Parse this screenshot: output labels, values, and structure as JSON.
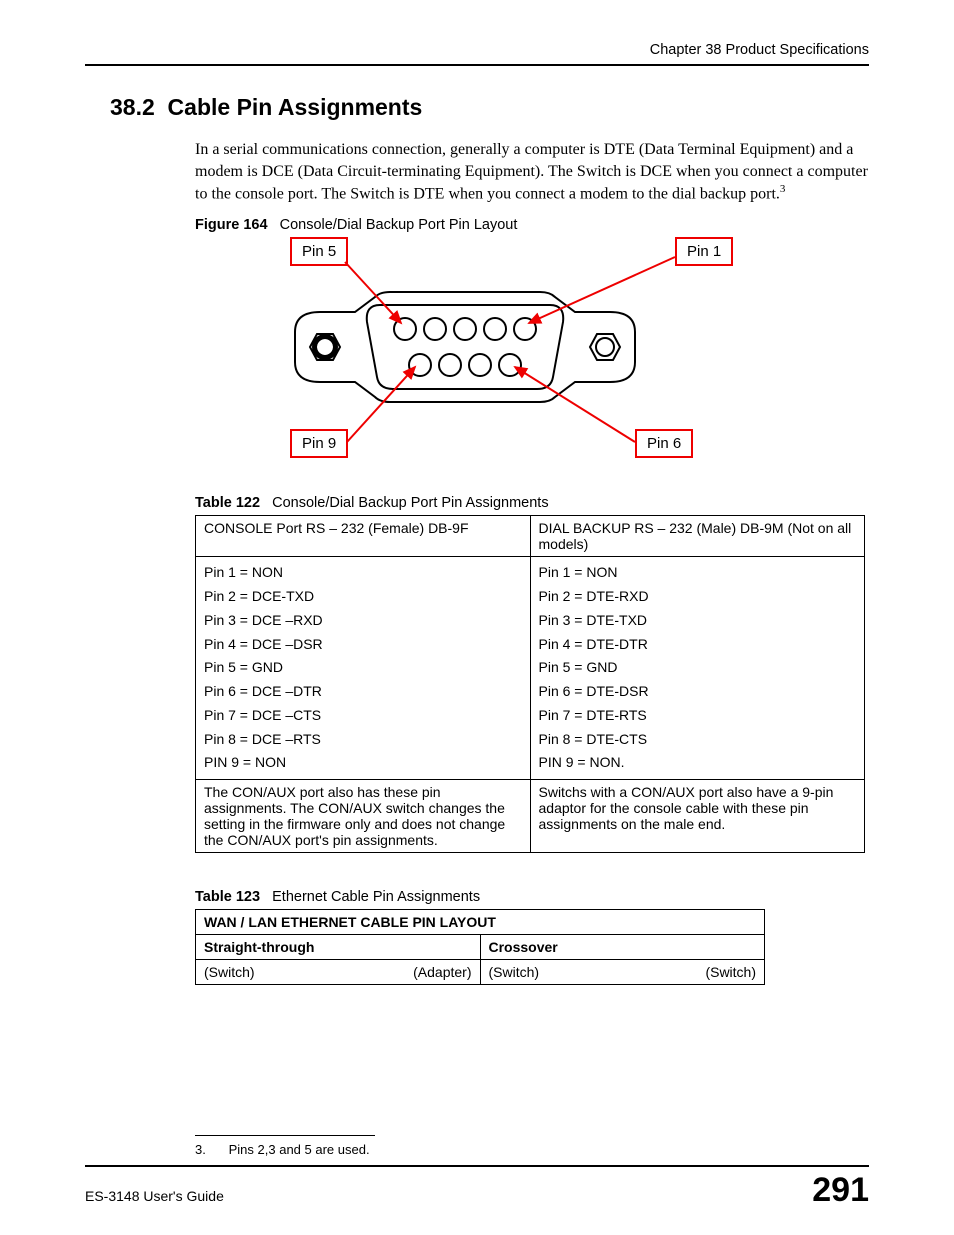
{
  "chapter_header": "Chapter 38 Product Specifications",
  "section": {
    "number": "38.2",
    "title": "Cable Pin Assignments"
  },
  "body_paragraph": "In a serial communications connection, generally a computer is DTE (Data Terminal Equipment) and a modem is DCE (Data Circuit-terminating Equipment). The Switch is DCE when you connect a computer to the console port. The Switch is DTE when you connect a modem to the dial backup port.",
  "footnote_marker": "3",
  "figure": {
    "label": "Figure 164",
    "caption": "Console/Dial Backup Port Pin Layout",
    "pins": {
      "top_left": "Pin 5",
      "top_right": "Pin 1",
      "bottom_left": "Pin 9",
      "bottom_right": "Pin 6"
    }
  },
  "table122": {
    "label": "Table 122",
    "caption": "Console/Dial Backup Port Pin Assignments",
    "header_left": "CONSOLE Port RS – 232 (Female) DB-9F",
    "header_right": "DIAL BACKUP RS – 232 (Male) DB-9M (Not on all models)",
    "left_pins": [
      "Pin 1 = NON",
      "Pin 2 = DCE-TXD",
      "Pin 3 = DCE –RXD",
      "Pin 4 = DCE –DSR",
      "Pin 5 = GND",
      "Pin 6 = DCE –DTR",
      "Pin 7 = DCE –CTS",
      "Pin 8 = DCE –RTS",
      "PIN 9 = NON"
    ],
    "right_pins": [
      "Pin 1 = NON",
      "Pin 2 = DTE-RXD",
      "Pin 3 = DTE-TXD",
      "Pin 4 = DTE-DTR",
      "Pin 5 = GND",
      "Pin 6 = DTE-DSR",
      "Pin 7 = DTE-RTS",
      "Pin 8 = DTE-CTS",
      "PIN 9 = NON."
    ],
    "note_left": "The CON/AUX port also has these pin assignments. The CON/AUX switch changes the setting in the firmware only and does not change the CON/AUX port's pin assignments.",
    "note_right": "Switchs with a CON/AUX port also have a 9-pin adaptor for the console cable with these pin assignments on the male end."
  },
  "table123": {
    "label": "Table 123",
    "caption": "Ethernet Cable Pin Assignments",
    "header": "WAN / LAN ETHERNET CABLE PIN LAYOUT",
    "col_left": "Straight-through",
    "col_right": "Crossover",
    "row": {
      "l1": "(Switch)",
      "l2": "(Adapter)",
      "r1": "(Switch)",
      "r2": "(Switch)"
    }
  },
  "footnote": {
    "num": "3.",
    "text": "Pins 2,3 and 5 are used."
  },
  "footer": {
    "guide": "ES-3148 User's Guide",
    "page_number": "291"
  }
}
